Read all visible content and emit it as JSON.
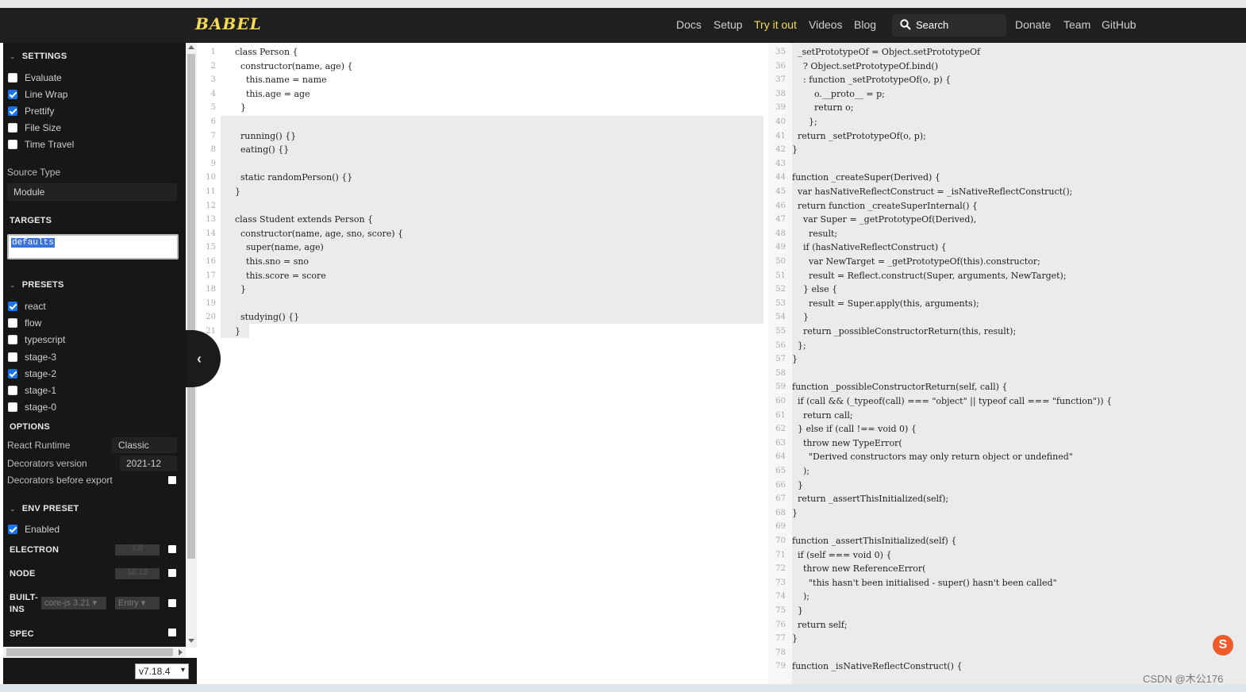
{
  "header": {
    "logo": "BABEL",
    "nav": [
      "Docs",
      "Setup",
      "Try it out",
      "Videos",
      "Blog"
    ],
    "active_nav": "Try it out",
    "search": "Search",
    "nav_right": [
      "Donate",
      "Team",
      "GitHub"
    ]
  },
  "sidebar": {
    "settings_title": "SETTINGS",
    "settings": [
      {
        "label": "Evaluate",
        "checked": false
      },
      {
        "label": "Line Wrap",
        "checked": true
      },
      {
        "label": "Prettify",
        "checked": true
      },
      {
        "label": "File Size",
        "checked": false
      },
      {
        "label": "Time Travel",
        "checked": false
      }
    ],
    "source_type_label": "Source Type",
    "source_type_value": "Module",
    "targets_title": "TARGETS",
    "targets_value": "defaults",
    "presets_title": "PRESETS",
    "presets": [
      {
        "label": "react",
        "checked": true
      },
      {
        "label": "flow",
        "checked": false
      },
      {
        "label": "typescript",
        "checked": false
      },
      {
        "label": "stage-3",
        "checked": false
      },
      {
        "label": "stage-2",
        "checked": true
      },
      {
        "label": "stage-1",
        "checked": false
      },
      {
        "label": "stage-0",
        "checked": false
      }
    ],
    "options_title": "OPTIONS",
    "react_runtime_label": "React Runtime",
    "react_runtime_value": "Classic",
    "decorators_version_label": "Decorators version",
    "decorators_version_value": "2021-12",
    "decorators_before_export_label": "Decorators before export",
    "env_preset_title": "ENV PRESET",
    "env_enabled_label": "Enabled",
    "env_enabled": true,
    "electron_label": "ELECTRON",
    "electron_value": "1.8",
    "node_label": "NODE",
    "node_value": "10.13",
    "builtins_label": "BUILT-\nINS",
    "builtins_corejs": "core-js 3.21",
    "builtins_mode": "Entry",
    "spec_label": "SPEC",
    "version": "v7.18.4"
  },
  "left_code": [
    {
      "n": "1",
      "t": "    class Person {"
    },
    {
      "n": "2",
      "t": "      constructor(name, age) {"
    },
    {
      "n": "3",
      "t": "        this.name = name"
    },
    {
      "n": "4",
      "t": "        this.age = age"
    },
    {
      "n": "5",
      "t": "      }"
    },
    {
      "n": "6",
      "t": ""
    },
    {
      "n": "7",
      "t": "      running() {}"
    },
    {
      "n": "8",
      "t": "      eating() {}"
    },
    {
      "n": "9",
      "t": ""
    },
    {
      "n": "10",
      "t": "      static randomPerson() {}"
    },
    {
      "n": "11",
      "t": "    }"
    },
    {
      "n": "12",
      "t": ""
    },
    {
      "n": "13",
      "t": "    class Student extends Person {"
    },
    {
      "n": "14",
      "t": "      constructor(name, age, sno, score) {"
    },
    {
      "n": "15",
      "t": "        super(name, age)"
    },
    {
      "n": "16",
      "t": "        this.sno = sno"
    },
    {
      "n": "17",
      "t": "        this.score = score"
    },
    {
      "n": "18",
      "t": "      }"
    },
    {
      "n": "19",
      "t": ""
    },
    {
      "n": "20",
      "t": "      studying() {}"
    },
    {
      "n": "21",
      "t": "    }"
    }
  ],
  "right_code": [
    {
      "n": "35",
      "t": "  _setPrototypeOf = Object.setPrototypeOf"
    },
    {
      "n": "36",
      "t": "    ? Object.setPrototypeOf.bind()"
    },
    {
      "n": "37",
      "t": "    : function _setPrototypeOf(o, p) {"
    },
    {
      "n": "38",
      "t": "        o.__proto__ = p;"
    },
    {
      "n": "39",
      "t": "        return o;"
    },
    {
      "n": "40",
      "t": "      };"
    },
    {
      "n": "41",
      "t": "  return _setPrototypeOf(o, p);"
    },
    {
      "n": "42",
      "t": "}"
    },
    {
      "n": "43",
      "t": ""
    },
    {
      "n": "44",
      "t": "function _createSuper(Derived) {"
    },
    {
      "n": "45",
      "t": "  var hasNativeReflectConstruct = _isNativeReflectConstruct();"
    },
    {
      "n": "46",
      "t": "  return function _createSuperInternal() {"
    },
    {
      "n": "47",
      "t": "    var Super = _getPrototypeOf(Derived),"
    },
    {
      "n": "48",
      "t": "      result;"
    },
    {
      "n": "49",
      "t": "    if (hasNativeReflectConstruct) {"
    },
    {
      "n": "50",
      "t": "      var NewTarget = _getPrototypeOf(this).constructor;"
    },
    {
      "n": "51",
      "t": "      result = Reflect.construct(Super, arguments, NewTarget);"
    },
    {
      "n": "52",
      "t": "    } else {"
    },
    {
      "n": "53",
      "t": "      result = Super.apply(this, arguments);"
    },
    {
      "n": "54",
      "t": "    }"
    },
    {
      "n": "55",
      "t": "    return _possibleConstructorReturn(this, result);"
    },
    {
      "n": "56",
      "t": "  };"
    },
    {
      "n": "57",
      "t": "}"
    },
    {
      "n": "58",
      "t": ""
    },
    {
      "n": "59",
      "t": "function _possibleConstructorReturn(self, call) {"
    },
    {
      "n": "60",
      "t": "  if (call && (_typeof(call) === \"object\" || typeof call === \"function\")) {"
    },
    {
      "n": "61",
      "t": "    return call;"
    },
    {
      "n": "62",
      "t": "  } else if (call !== void 0) {"
    },
    {
      "n": "63",
      "t": "    throw new TypeError("
    },
    {
      "n": "64",
      "t": "      \"Derived constructors may only return object or undefined\""
    },
    {
      "n": "65",
      "t": "    );"
    },
    {
      "n": "66",
      "t": "  }"
    },
    {
      "n": "67",
      "t": "  return _assertThisInitialized(self);"
    },
    {
      "n": "68",
      "t": "}"
    },
    {
      "n": "69",
      "t": ""
    },
    {
      "n": "70",
      "t": "function _assertThisInitialized(self) {"
    },
    {
      "n": "71",
      "t": "  if (self === void 0) {"
    },
    {
      "n": "72",
      "t": "    throw new ReferenceError("
    },
    {
      "n": "73",
      "t": "      \"this hasn't been initialised - super() hasn't been called\""
    },
    {
      "n": "74",
      "t": "    );"
    },
    {
      "n": "75",
      "t": "  }"
    },
    {
      "n": "76",
      "t": "  return self;"
    },
    {
      "n": "77",
      "t": "}"
    },
    {
      "n": "78",
      "t": ""
    },
    {
      "n": "79",
      "t": "function _isNativeReflectConstruct() {"
    }
  ],
  "watermark": "CSDN @木公176",
  "colors": {
    "accent": "#f5da55",
    "check": "#1a73e8",
    "sidebar": "#171717"
  }
}
